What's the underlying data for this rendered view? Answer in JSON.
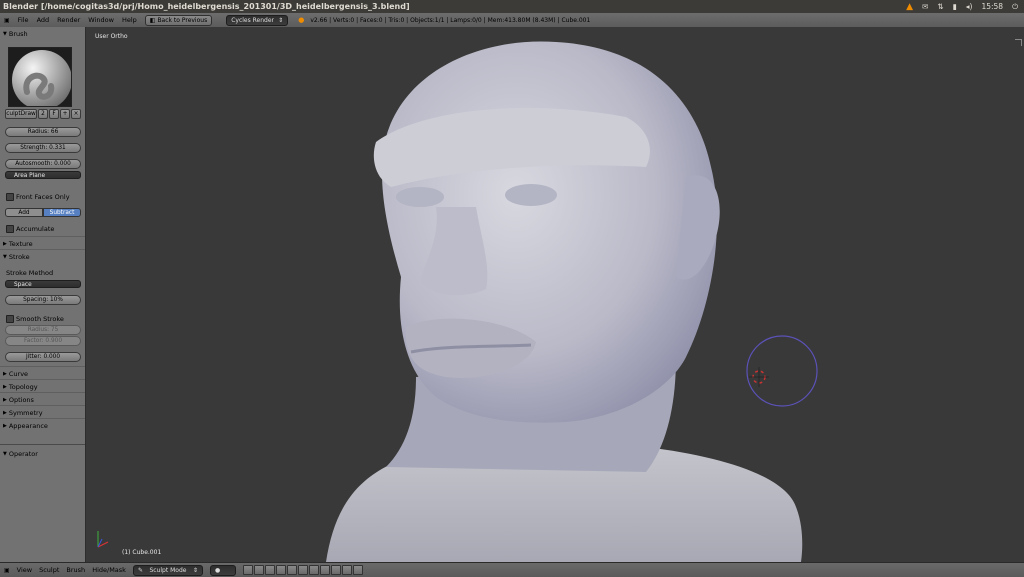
{
  "window": {
    "title": "Blender [/home/cogitas3d/prj/Homo_heidelbergensis_201301/3D_heidelbergensis_3.blend]",
    "clock": "15:58"
  },
  "info_header": {
    "menu": [
      "File",
      "Add",
      "Render",
      "Window",
      "Help"
    ],
    "back_button": "Back to Previous",
    "render_engine": "Cycles Render",
    "stats": "v2.66 | Verts:0 | Faces:0 | Tris:0 | Objects:1/1 | Lamps:0/0 | Mem:413.80M (8.43M) | Cube.001"
  },
  "tool_panel": {
    "brush_header": "Brush",
    "brush_name": "culptDraw",
    "brush_users": "2",
    "brush_fake": "F",
    "radius": "Radius: 66",
    "strength": "Strength: 0.331",
    "autosmooth": "Autosmooth: 0.000",
    "plane": "Area Plane",
    "front_faces": "Front Faces Only",
    "add": "Add",
    "subtract": "Subtract",
    "accumulate": "Accumulate",
    "texture": "Texture",
    "stroke": "Stroke",
    "stroke_method_label": "Stroke Method",
    "stroke_method": "Space",
    "spacing": "Spacing: 10%",
    "smooth_stroke": "Smooth Stroke",
    "smooth_radius": "Radius: 75",
    "smooth_factor": "Factor: 0.900",
    "jitter": "Jitter: 0.000",
    "curve": "Curve",
    "topology": "Topology",
    "options": "Options",
    "symmetry": "Symmetry",
    "appearance": "Appearance",
    "operator": "Operator"
  },
  "viewport": {
    "view_name": "User Ortho",
    "object_info": "(1) Cube.001"
  },
  "footer": {
    "menu": [
      "View",
      "Sculpt",
      "Brush",
      "Hide/Mask"
    ],
    "mode": "Sculpt Mode"
  },
  "colors": {
    "accent_blue": "#5680c2",
    "panel": "#727272",
    "viewport": "#393939"
  }
}
